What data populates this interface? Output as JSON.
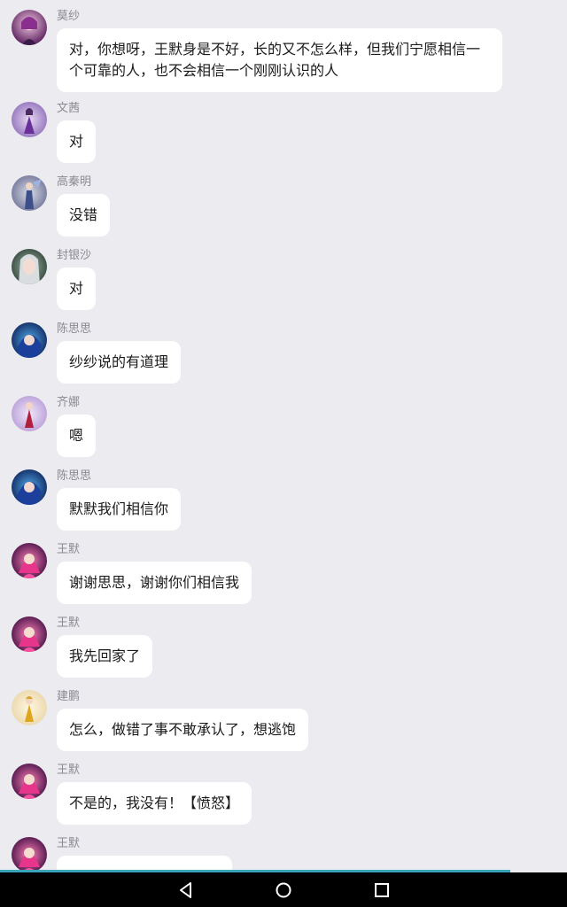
{
  "colors": {
    "background": "#ebebf0",
    "bubble": "#ffffff",
    "sender_name": "#8a8a90",
    "message_text": "#1a1a1a",
    "progress_bar": "#3aa5b8",
    "navbar": "#000000"
  },
  "messages": [
    {
      "sender": "莫纱",
      "text": "对，你想呀，王默身是不好，长的又不怎么样，但我们宁愿相信一个可靠的人，也不会相信一个刚刚认识的人",
      "avatar": "purple-haired-girl-avatar"
    },
    {
      "sender": "文茜",
      "text": "对",
      "avatar": "purple-dress-girl-avatar"
    },
    {
      "sender": "高秦明",
      "text": "没错",
      "avatar": "blue-armored-boy-avatar"
    },
    {
      "sender": "封银沙",
      "text": "对",
      "avatar": "silver-haired-girl-avatar"
    },
    {
      "sender": "陈思思",
      "text": "纱纱说的有道理",
      "avatar": "blue-haired-girl-avatar"
    },
    {
      "sender": "齐娜",
      "text": "嗯",
      "avatar": "red-dress-girl-avatar"
    },
    {
      "sender": "陈思思",
      "text": "默默我们相信你",
      "avatar": "blue-haired-girl-avatar"
    },
    {
      "sender": "王默",
      "text": "谢谢思思，谢谢你们相信我",
      "avatar": "pink-haired-girl-avatar"
    },
    {
      "sender": "王默",
      "text": "我先回家了",
      "avatar": "pink-haired-girl-avatar"
    },
    {
      "sender": "建鹏",
      "text": "怎么，做错了事不敢承认了，想逃饱",
      "avatar": "yellow-haired-boy-avatar"
    },
    {
      "sender": "王默",
      "text": "不是的，我没有！【愤怒】",
      "avatar": "pink-haired-girl-avatar"
    },
    {
      "sender": "王默",
      "text": "",
      "avatar": "pink-haired-girl-avatar"
    }
  ],
  "navbar": {
    "back": "back-triangle-icon",
    "home": "home-circle-icon",
    "recents": "recents-square-icon"
  }
}
